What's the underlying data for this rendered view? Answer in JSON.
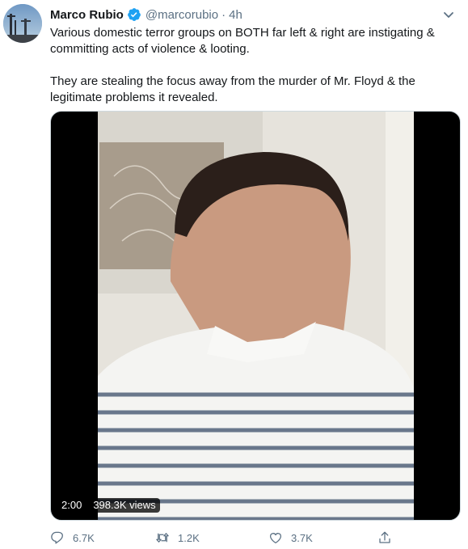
{
  "tweet": {
    "author_name": "Marco Rubio",
    "handle": "@marcorubio",
    "separator": "·",
    "time": "4h",
    "paragraphs": [
      "Various domestic terror groups on BOTH far left & right are instigating & committing acts of violence & looting.",
      "They are stealing the focus away from the murder of Mr. Floyd & the legitimate problems it revealed."
    ]
  },
  "video": {
    "duration": "2:00",
    "views": "398.3K views"
  },
  "actions": {
    "replies": "6.7K",
    "retweets": "1.2K",
    "likes": "3.7K"
  },
  "icons": {
    "verified": "verified-badge-icon",
    "more": "chevron-down-icon",
    "reply": "reply-icon",
    "retweet": "retweet-icon",
    "like": "heart-icon",
    "share": "share-icon"
  },
  "colors": {
    "verified": "#1da1f2",
    "secondary_text": "#5b7083",
    "primary_text": "#14171a"
  }
}
